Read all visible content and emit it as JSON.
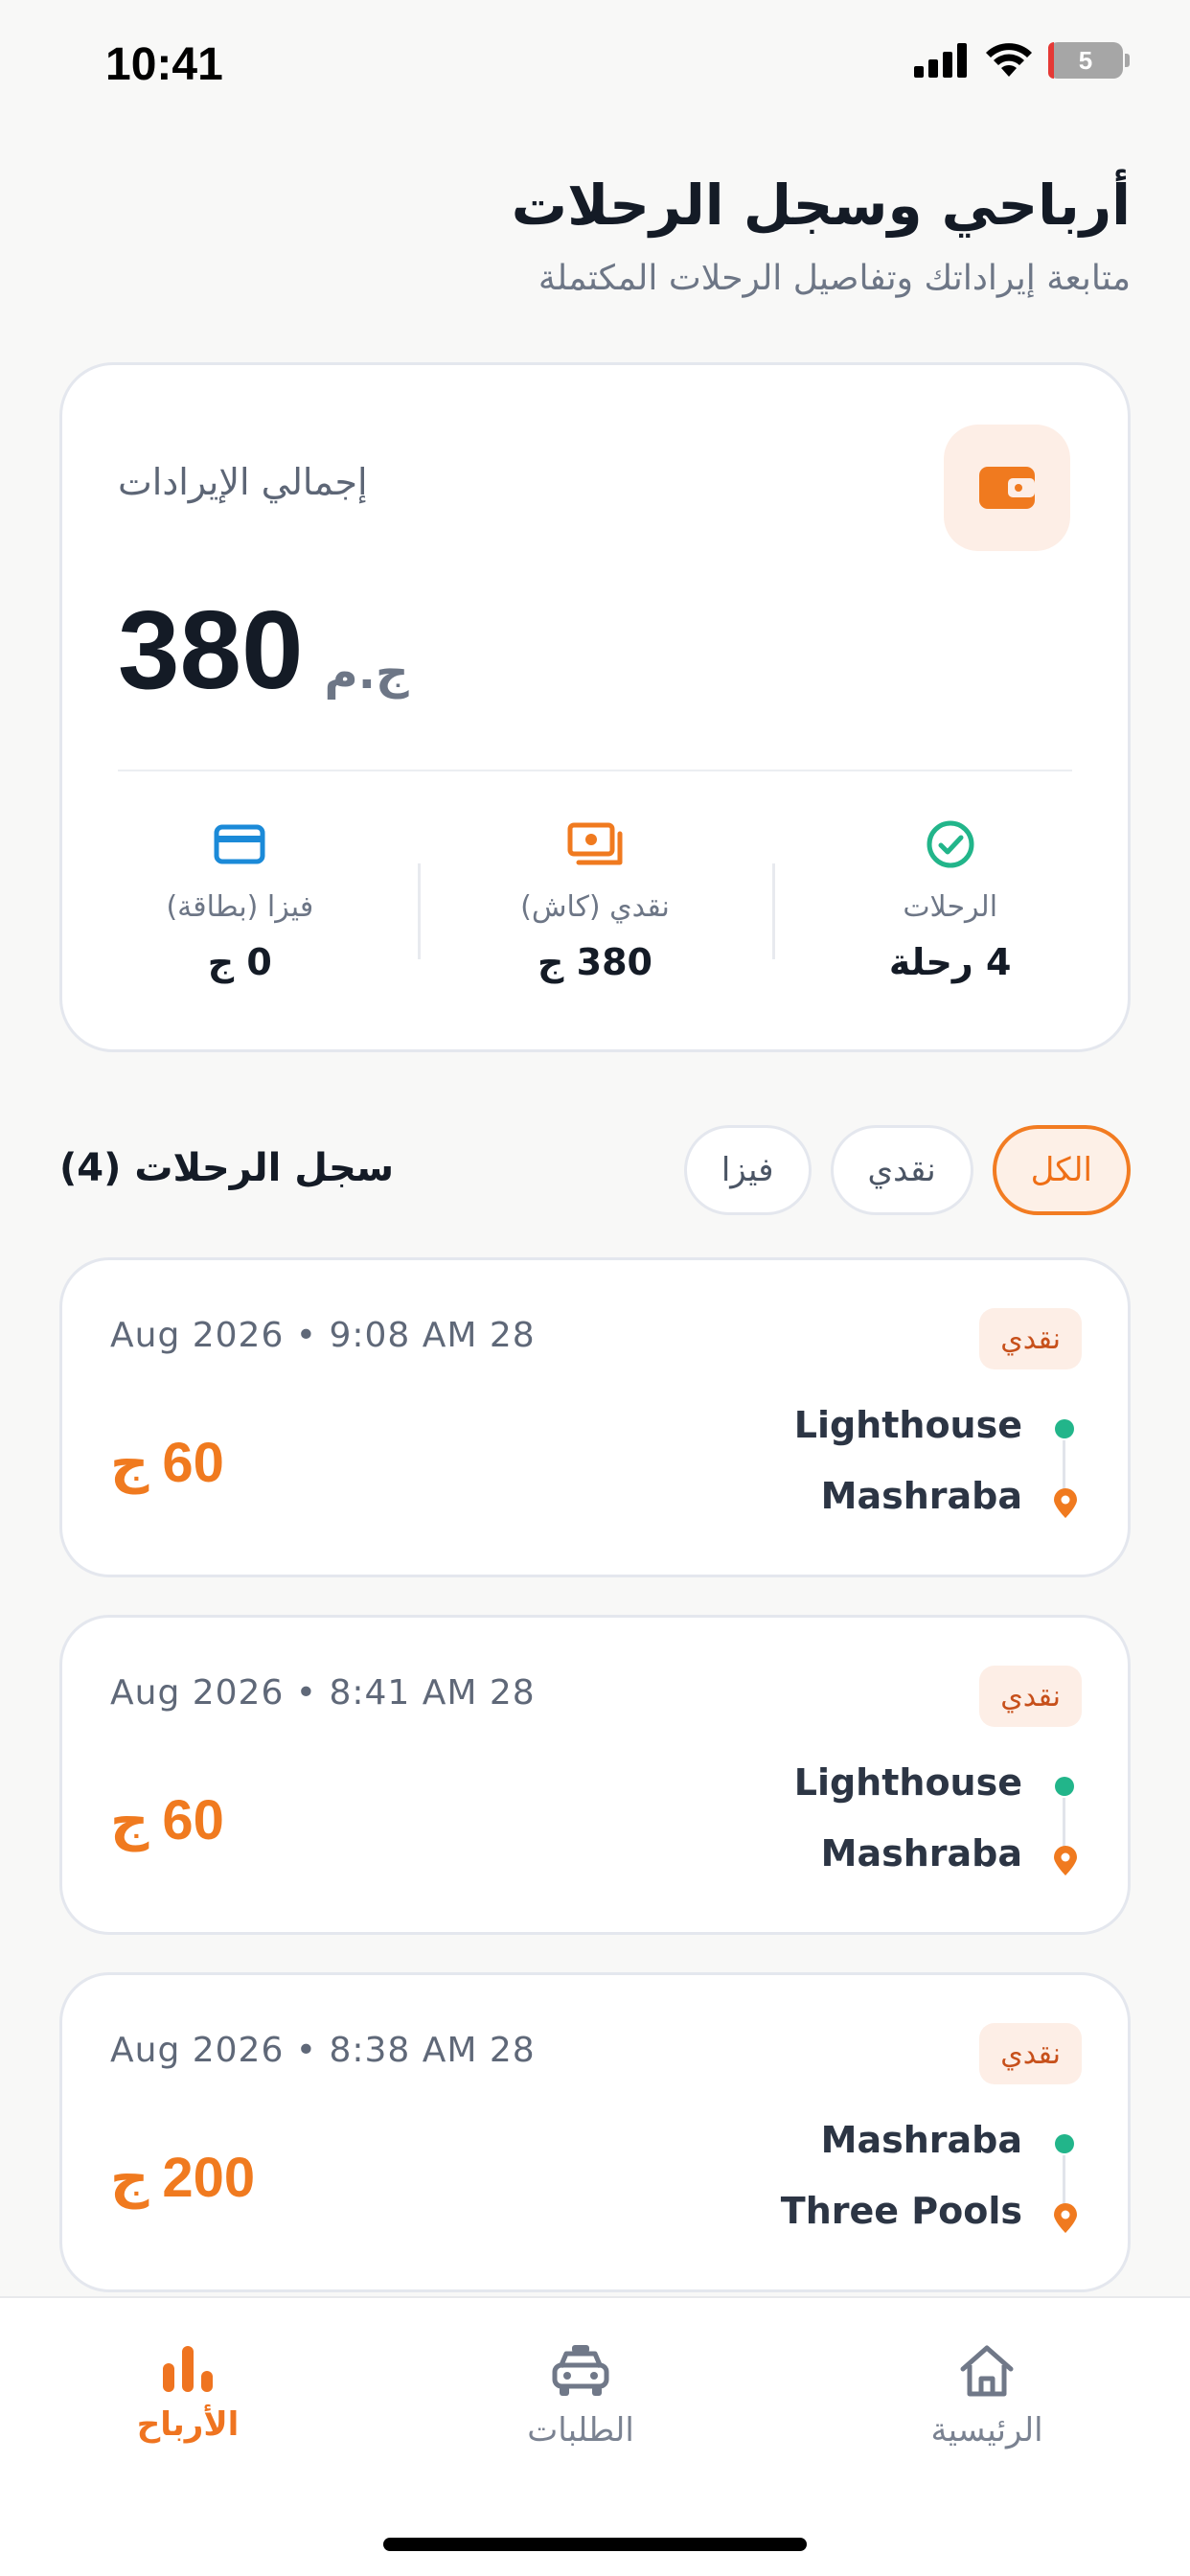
{
  "status_bar": {
    "time": "10:41",
    "battery": "5"
  },
  "header": {
    "title": "أرباحي وسجل الرحلات",
    "subtitle": "متابعة إيراداتك وتفاصيل الرحلات المكتملة"
  },
  "summary": {
    "label": "إجمالي الإيرادات",
    "total": "380",
    "currency": "ج.م",
    "stats": [
      {
        "label": "فيزا (بطاقة)",
        "value": "0 ج",
        "icon": "card-icon",
        "color": "#1b8ad8"
      },
      {
        "label": "نقدي (كاش)",
        "value": "380 ج",
        "icon": "cash-icon",
        "color": "#f07a1f"
      },
      {
        "label": "الرحلات",
        "value": "4 رحلة",
        "icon": "check-circle-icon",
        "color": "#22b58a"
      }
    ]
  },
  "history": {
    "title": "سجل الرحلات (4)",
    "filters": [
      {
        "label": "الكل",
        "active": true
      },
      {
        "label": "نقدي",
        "active": false
      },
      {
        "label": "فيزا",
        "active": false
      }
    ],
    "trips": [
      {
        "date": "Aug 2026 • 9:08 AM 28",
        "badge": "نقدي",
        "amount": "60",
        "currency": "ج",
        "from": "Lighthouse",
        "to": "Mashraba"
      },
      {
        "date": "Aug 2026 • 8:41 AM 28",
        "badge": "نقدي",
        "amount": "60",
        "currency": "ج",
        "from": "Lighthouse",
        "to": "Mashraba"
      },
      {
        "date": "Aug 2026 • 8:38 AM 28",
        "badge": "نقدي",
        "amount": "200",
        "currency": "ج",
        "from": "Mashraba",
        "to": "Three Pools"
      }
    ]
  },
  "tab_bar": {
    "items": [
      {
        "label": "الأرباح",
        "icon": "bar-chart-icon",
        "active": true
      },
      {
        "label": "الطلبات",
        "icon": "car-icon",
        "active": false
      },
      {
        "label": "الرئيسية",
        "icon": "home-icon",
        "active": false
      }
    ]
  },
  "colors": {
    "accent": "#f07a1f",
    "success": "#22b58a",
    "info": "#1b8ad8"
  }
}
